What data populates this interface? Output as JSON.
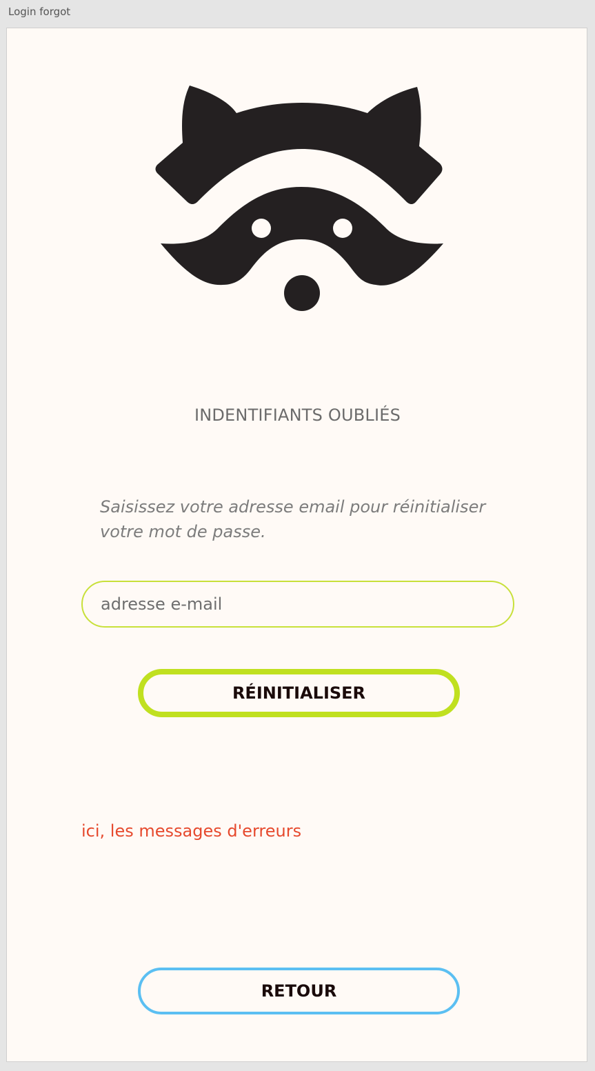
{
  "window": {
    "title": "Login forgot"
  },
  "logo": {
    "icon": "raccoon-logo-icon",
    "color": "#242021"
  },
  "heading": "INDENTIFIANTS OUBLIÉS",
  "instructions": "Saisissez votre adresse email pour réinitialiser votre mot de passe.",
  "email": {
    "placeholder": "adresse e-mail",
    "value": ""
  },
  "buttons": {
    "reset_label": "RÉINITIALISER",
    "back_label": "RETOUR"
  },
  "error_message": "ici, les messages d'erreurs",
  "colors": {
    "accent_green": "#c0e020",
    "accent_blue": "#5bbff2",
    "error_red": "#e6492d",
    "background": "#fffaf6"
  }
}
